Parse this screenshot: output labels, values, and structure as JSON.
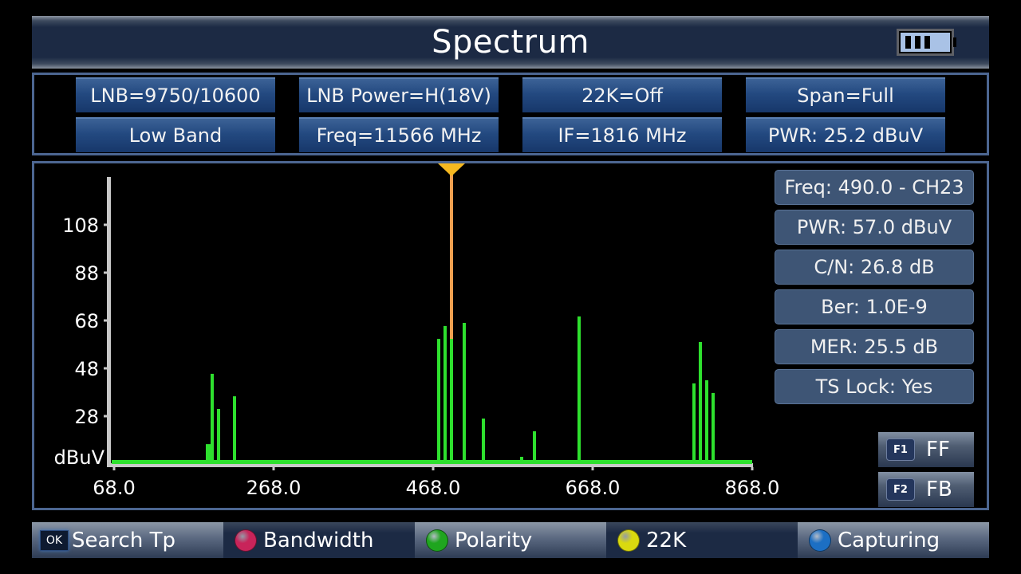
{
  "header": {
    "title": "Spectrum",
    "battery_icon": "battery-icon",
    "battery_level_bars": 3,
    "battery_max_bars": 4
  },
  "params": [
    {
      "id": "lnb",
      "label": "LNB=9750/10600"
    },
    {
      "id": "lnb-power",
      "label": "LNB Power=H(18V)"
    },
    {
      "id": "22k",
      "label": "22K=Off"
    },
    {
      "id": "span",
      "label": "Span=Full"
    },
    {
      "id": "band",
      "label": "Low Band"
    },
    {
      "id": "freq",
      "label": "Freq=11566 MHz"
    },
    {
      "id": "if",
      "label": "IF=1816 MHz"
    },
    {
      "id": "pwr",
      "label": "PWR: 25.2 dBuV"
    }
  ],
  "info": [
    {
      "id": "freq",
      "label": "Freq: 490.0 - CH23"
    },
    {
      "id": "pwr",
      "label": "PWR: 57.0 dBuV"
    },
    {
      "id": "cn",
      "label": "C/N: 26.8 dB"
    },
    {
      "id": "ber",
      "label": "Ber: 1.0E-9"
    },
    {
      "id": "mer",
      "label": "MER: 25.5 dB"
    },
    {
      "id": "ts-lock",
      "label": "TS Lock: Yes"
    }
  ],
  "function_keys": [
    {
      "key": "F1",
      "label": "FF"
    },
    {
      "key": "F2",
      "label": "FB"
    }
  ],
  "footer": [
    {
      "key": "OK",
      "label": "Search Tp",
      "icon": "ok-key-icon"
    },
    {
      "color": "#c8245a",
      "label": "Bandwidth",
      "icon": "red-button-icon"
    },
    {
      "color": "#1fa51f",
      "label": "Polarity",
      "icon": "green-button-icon"
    },
    {
      "color": "#d9d90f",
      "label": "22K",
      "icon": "yellow-button-icon"
    },
    {
      "color": "#1c6fc4",
      "label": "Capturing",
      "icon": "blue-button-icon"
    }
  ],
  "colors": {
    "signal": "#2ee02e",
    "marker": "#f0a050",
    "marker_head": "#f5b820",
    "axis": "#c8c8c8"
  },
  "chart_data": {
    "type": "bar",
    "title": "",
    "xlabel": "",
    "ylabel": "dBuV",
    "xlim": [
      68.0,
      868.0
    ],
    "ylim": [
      9,
      128
    ],
    "x_ticks": [
      "68.0",
      "268.0",
      "468.0",
      "668.0",
      "868.0"
    ],
    "y_ticks": [
      "108",
      "88",
      "68",
      "48",
      "28"
    ],
    "noise_floor": 9,
    "marker_freq": 491,
    "series": [
      {
        "name": "Spectrum",
        "x": [
          186,
          191,
          199,
          219,
          475,
          483,
          491,
          507,
          531,
          579,
          595,
          651,
          795,
          803,
          811,
          819
        ],
        "values": [
          16.3,
          45.7,
          31,
          36.3,
          60.3,
          65.7,
          60.3,
          67,
          27,
          11,
          21.7,
          69.7,
          41.7,
          59,
          43,
          37.7
        ]
      }
    ]
  }
}
